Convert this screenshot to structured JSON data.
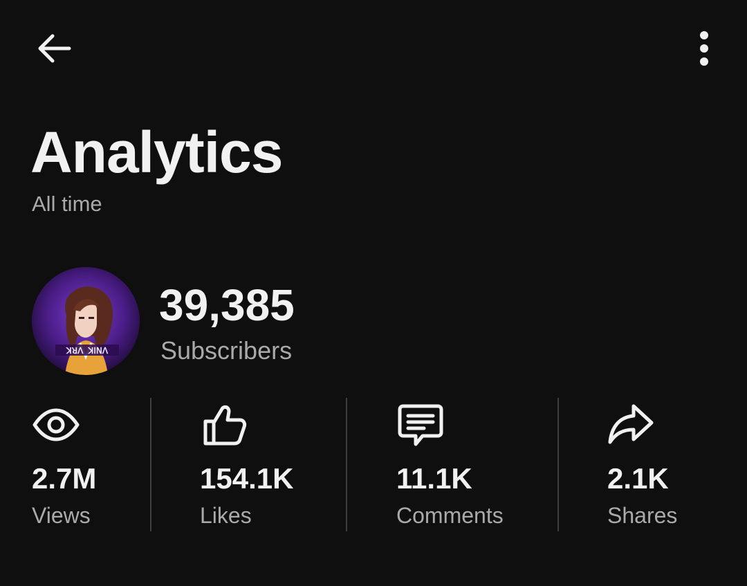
{
  "header": {
    "back_icon": "arrow-left-icon",
    "more_icon": "more-vertical-icon"
  },
  "page": {
    "title": "Analytics",
    "time_range": "All time"
  },
  "channel": {
    "avatar": "channel-avatar",
    "subscriber_count": "39,385",
    "subscriber_label": "Subscribers"
  },
  "stats": [
    {
      "icon": "eye-icon",
      "value": "2.7M",
      "label": "Views"
    },
    {
      "icon": "thumbs-up-icon",
      "value": "154.1K",
      "label": "Likes"
    },
    {
      "icon": "comment-icon",
      "value": "11.1K",
      "label": "Comments"
    },
    {
      "icon": "share-icon",
      "value": "2.1K",
      "label": "Shares"
    }
  ],
  "colors": {
    "background": "#0f0f0f",
    "primary_text": "#f1f1f1",
    "secondary_text": "#aaaaaa",
    "divider": "#3f3f3f",
    "avatar_accent": "#5b2a9e"
  }
}
